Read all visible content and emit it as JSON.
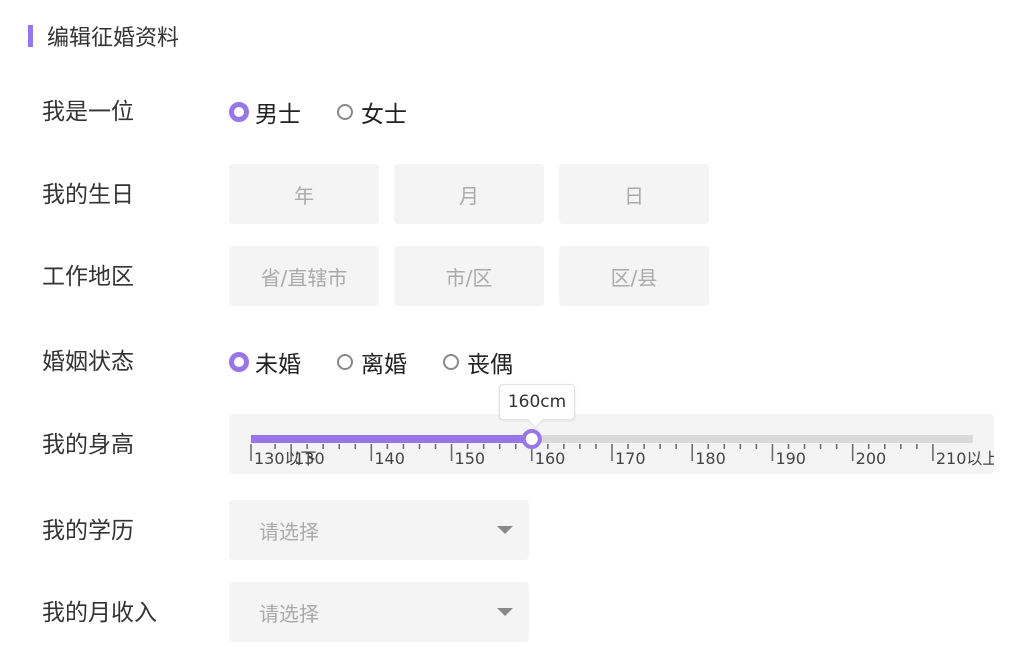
{
  "page_title": "编辑征婚资料",
  "accent_color": "#9876ea",
  "gender": {
    "label": "我是一位",
    "options": [
      {
        "label": "男士",
        "selected": true
      },
      {
        "label": "女士",
        "selected": false
      }
    ]
  },
  "birthday": {
    "label": "我的生日",
    "placeholders": [
      "年",
      "月",
      "日"
    ]
  },
  "work_region": {
    "label": "工作地区",
    "placeholders": [
      "省/直辖市",
      "市/区",
      "区/县"
    ]
  },
  "marital_status": {
    "label": "婚姻状态",
    "options": [
      {
        "label": "未婚",
        "selected": true
      },
      {
        "label": "离婚",
        "selected": false
      },
      {
        "label": "丧偶",
        "selected": false
      }
    ]
  },
  "height": {
    "label": "我的身高",
    "value": 160,
    "tooltip": "160cm",
    "min": 125,
    "max": 215,
    "tick_labels": [
      {
        "value": 125,
        "text": "130以下"
      },
      {
        "value": 130,
        "text": "130"
      },
      {
        "value": 140,
        "text": "140"
      },
      {
        "value": 150,
        "text": "150"
      },
      {
        "value": 160,
        "text": "160"
      },
      {
        "value": 170,
        "text": "170"
      },
      {
        "value": 180,
        "text": "180"
      },
      {
        "value": 190,
        "text": "190"
      },
      {
        "value": 200,
        "text": "200"
      },
      {
        "value": 210,
        "text": "210以上"
      }
    ]
  },
  "education": {
    "label": "我的学历",
    "placeholder": "请选择"
  },
  "income": {
    "label": "我的月收入",
    "placeholder": "请选择"
  }
}
